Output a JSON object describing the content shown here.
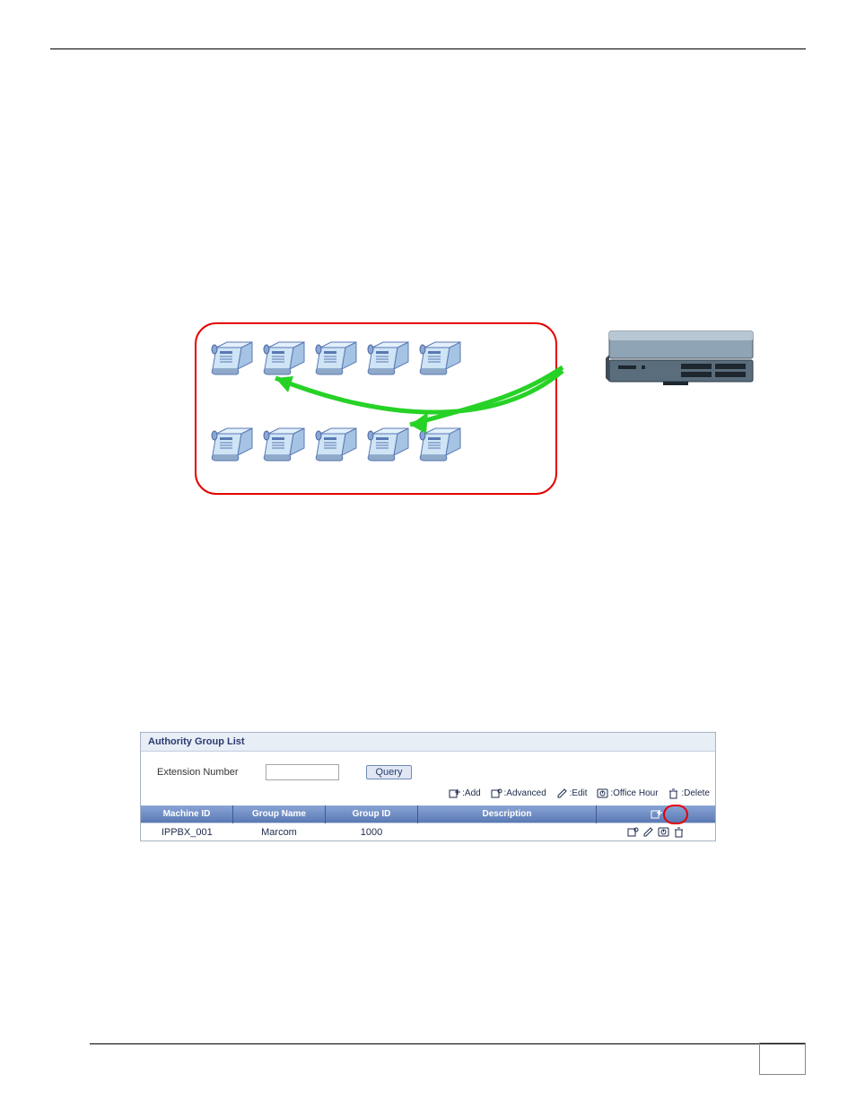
{
  "diagram": {
    "phones_top_count": 5,
    "phones_bottom_count": 5
  },
  "widget": {
    "title": "Authority Group List",
    "query_label": "Extension Number",
    "query_button": "Query",
    "legend": {
      "add": ":Add",
      "advanced": ":Advanced",
      "edit": ":Edit",
      "office_hour": ":Office Hour",
      "delete": ":Delete"
    },
    "columns": {
      "machine_id": "Machine ID",
      "group_name": "Group Name",
      "group_id": "Group ID",
      "description": "Description",
      "actions": ""
    },
    "rows": [
      {
        "machine_id": "IPPBX_001",
        "group_name": "Marcom",
        "group_id": "1000",
        "description": ""
      }
    ]
  }
}
